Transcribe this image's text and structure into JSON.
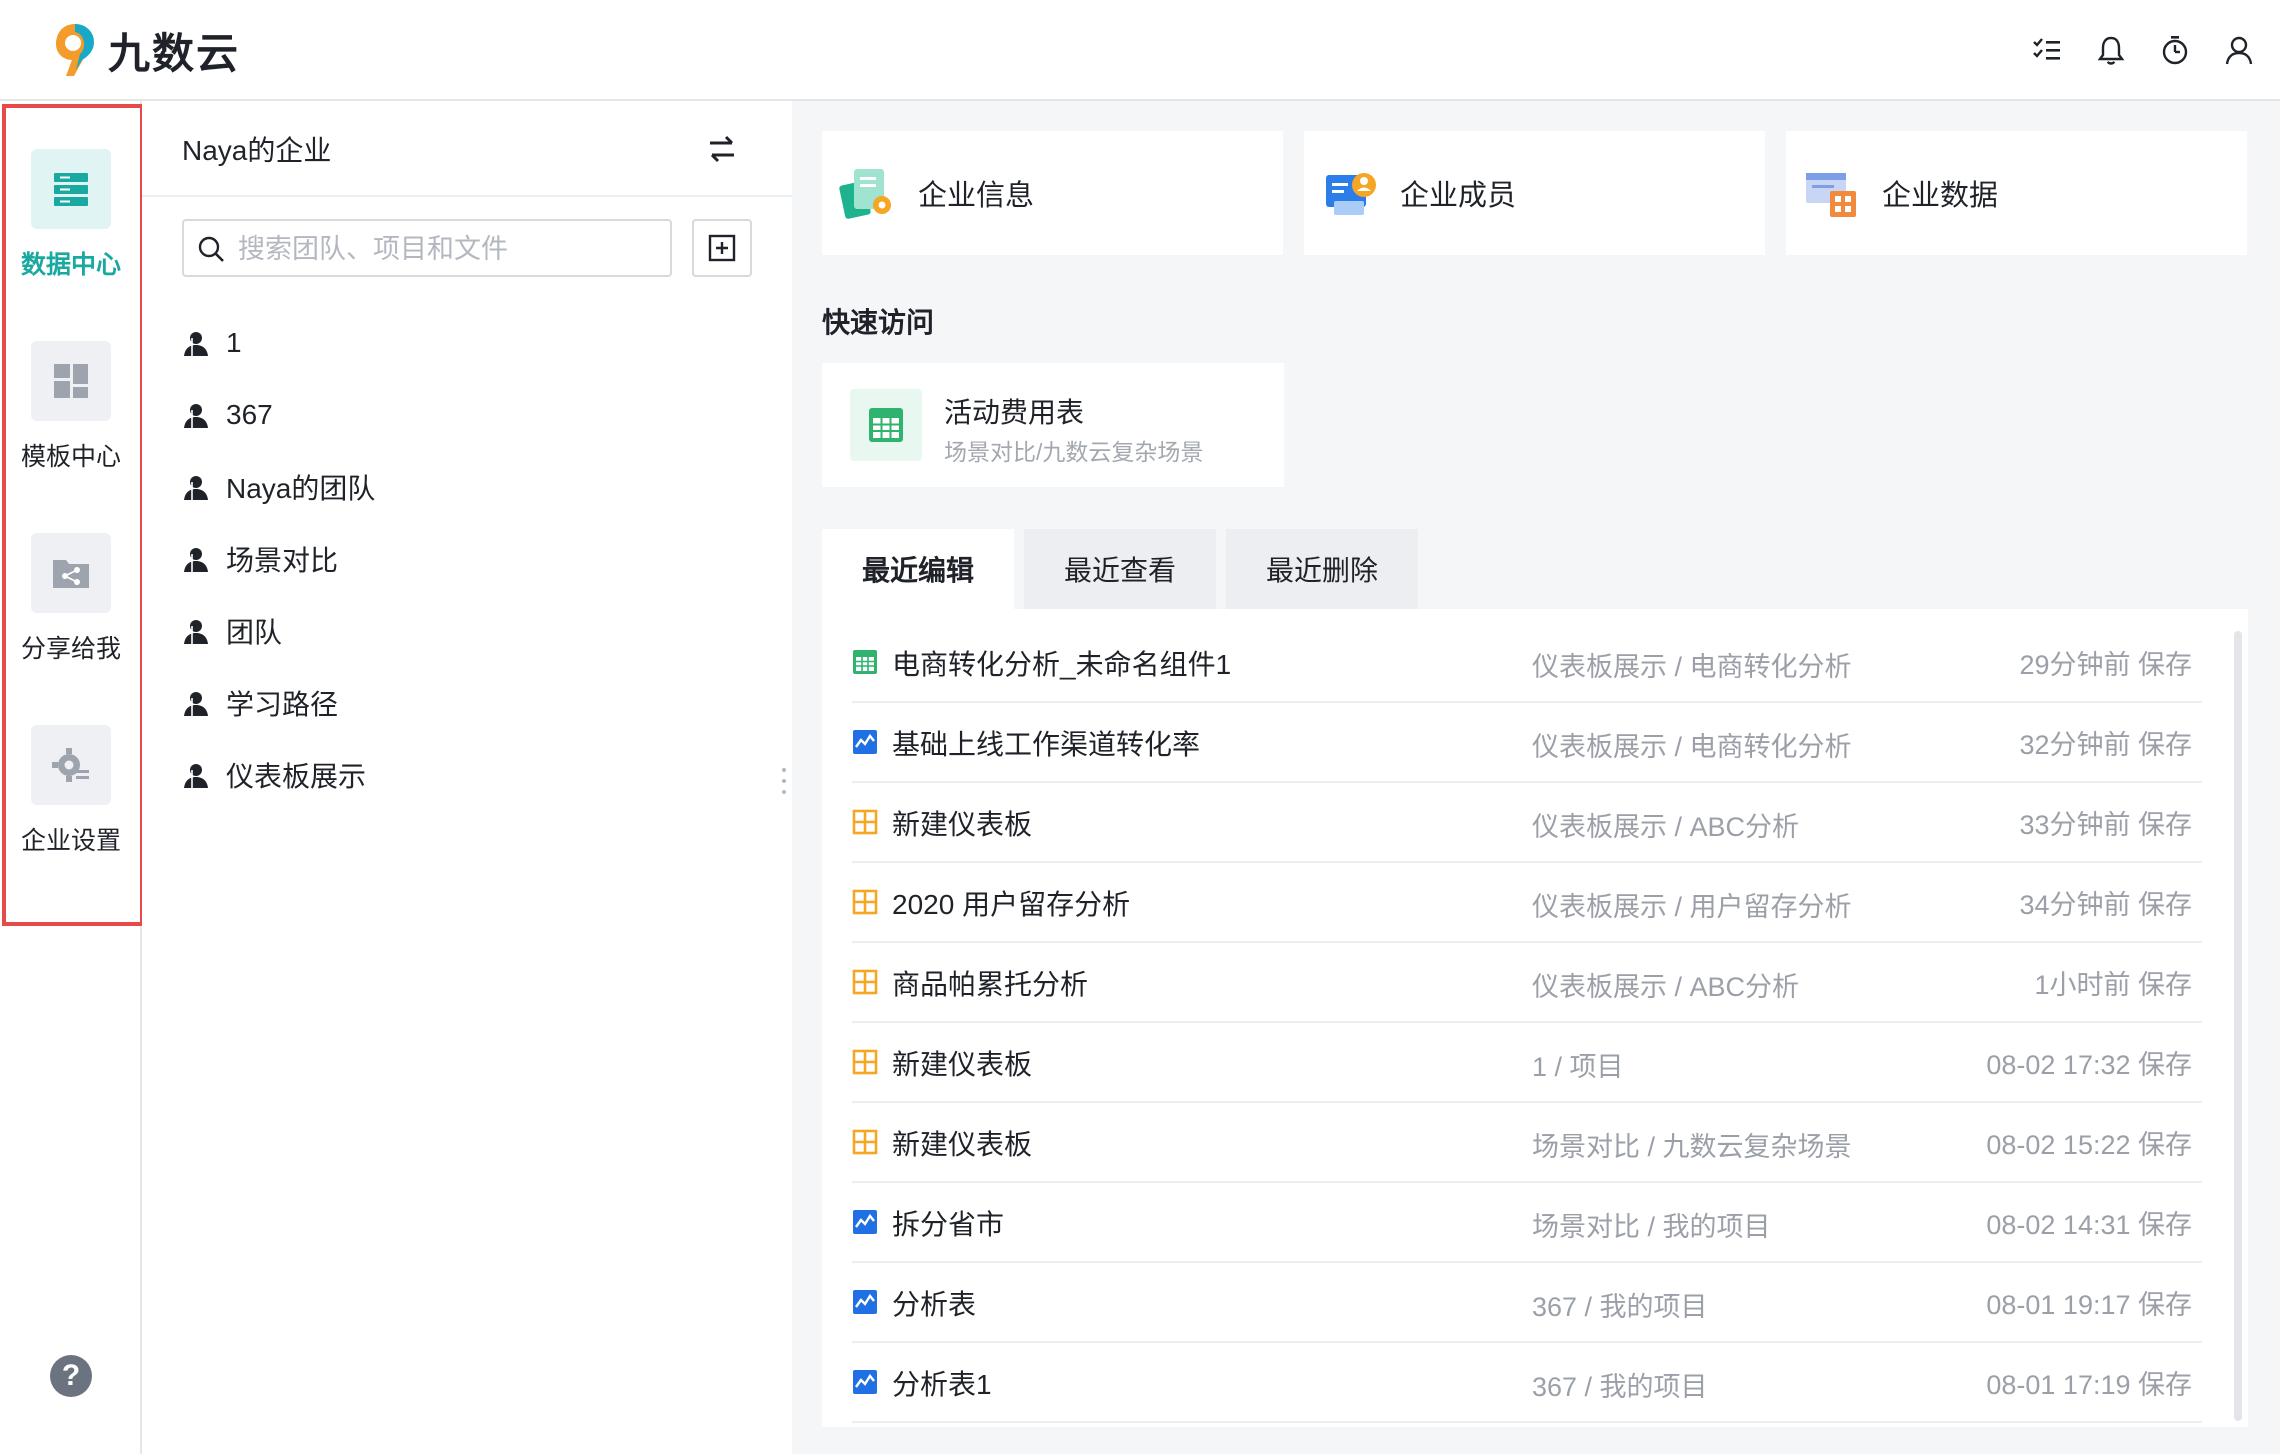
{
  "app": {
    "logo_text": "九数云"
  },
  "topbar": {
    "icons": [
      "task-list-icon",
      "bell-icon",
      "timer-icon",
      "user-icon"
    ]
  },
  "rail": {
    "items": [
      {
        "label": "数据中心",
        "icon": "data-center-icon",
        "active": true
      },
      {
        "label": "模板中心",
        "icon": "template-icon",
        "active": false
      },
      {
        "label": "分享给我",
        "icon": "shared-folder-icon",
        "active": false
      },
      {
        "label": "企业设置",
        "icon": "settings-icon",
        "active": false
      }
    ],
    "help_label": "?"
  },
  "tree": {
    "enterprise_name": "Naya的企业",
    "search_placeholder": "搜索团队、项目和文件",
    "teams": [
      "1",
      "367",
      "Naya的团队",
      "场景对比",
      "团队",
      "学习路径",
      "仪表板展示"
    ]
  },
  "cards": [
    {
      "label": "企业信息",
      "icon": "enterprise-info-icon"
    },
    {
      "label": "企业成员",
      "icon": "enterprise-members-icon"
    },
    {
      "label": "企业数据",
      "icon": "enterprise-data-icon"
    }
  ],
  "quick_access": {
    "title": "快速访问",
    "item": {
      "title": "活动费用表",
      "subtitle": "场景对比/九数云复杂场景"
    }
  },
  "tabs": [
    "最近编辑",
    "最近查看",
    "最近删除"
  ],
  "colors": {
    "accent": "#1aa9a0",
    "highlight_border": "#e8494b",
    "sheet_green": "#2fb36f",
    "chart_blue": "#1f6fe5",
    "dashboard_orange": "#f5a623"
  },
  "files": [
    {
      "name": "电商转化分析_未命名组件1",
      "path": "仪表板展示 / 电商转化分析",
      "time": "29分钟前 保存",
      "type": "sheet"
    },
    {
      "name": "基础上线工作渠道转化率",
      "path": "仪表板展示 / 电商转化分析",
      "time": "32分钟前 保存",
      "type": "chart"
    },
    {
      "name": "新建仪表板",
      "path": "仪表板展示 / ABC分析",
      "time": "33分钟前 保存",
      "type": "dashboard"
    },
    {
      "name": "2020 用户留存分析",
      "path": "仪表板展示 / 用户留存分析",
      "time": "34分钟前 保存",
      "type": "dashboard"
    },
    {
      "name": "商品帕累托分析",
      "path": "仪表板展示 / ABC分析",
      "time": "1小时前 保存",
      "type": "dashboard"
    },
    {
      "name": "新建仪表板",
      "path": "1    / 项目",
      "time": "08-02 17:32 保存",
      "type": "dashboard"
    },
    {
      "name": "新建仪表板",
      "path": "场景对比 / 九数云复杂场景",
      "time": "08-02 15:22 保存",
      "type": "dashboard"
    },
    {
      "name": "拆分省市",
      "path": "场景对比 / 我的项目",
      "time": "08-02 14:31 保存",
      "type": "chart"
    },
    {
      "name": "分析表",
      "path": "367 / 我的项目",
      "time": "08-01 19:17 保存",
      "type": "chart"
    },
    {
      "name": "分析表1",
      "path": "367 / 我的项目",
      "time": "08-01 17:19 保存",
      "type": "chart"
    }
  ]
}
